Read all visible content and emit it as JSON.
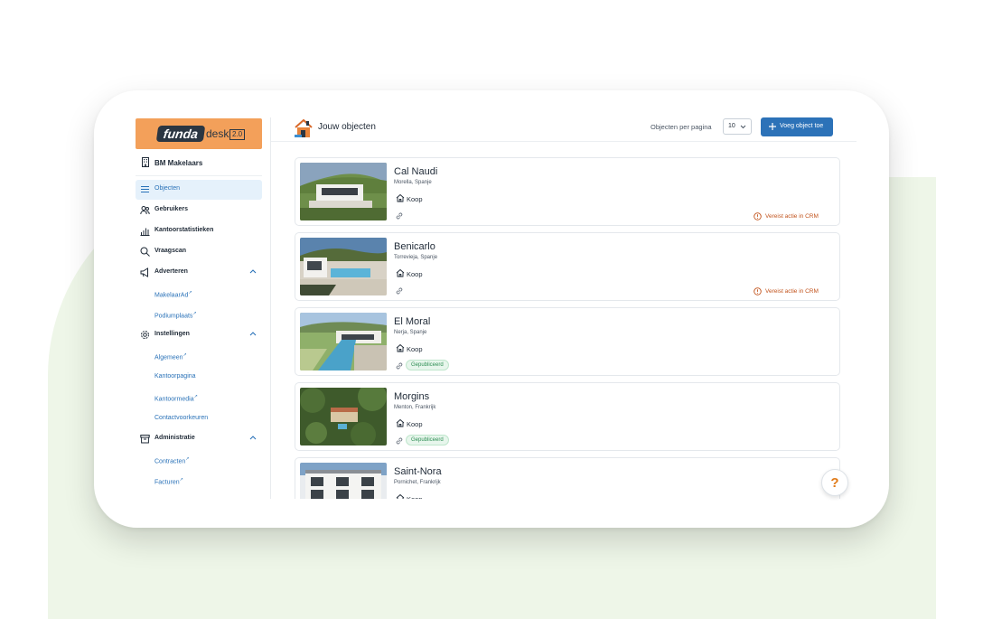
{
  "brand": {
    "logo_main": "funda",
    "logo_sub": "desk",
    "logo_version": "2.0"
  },
  "office": {
    "name": "BM Makelaars"
  },
  "sidebar": {
    "items": [
      {
        "label": "Objecten",
        "icon": "list-icon"
      },
      {
        "label": "Gebruikers",
        "icon": "users-icon"
      },
      {
        "label": "Kantoorstatistieken",
        "icon": "chart-icon"
      },
      {
        "label": "Vraagscan",
        "icon": "search-icon"
      },
      {
        "label": "Adverteren",
        "icon": "megaphone-icon"
      },
      {
        "label": "Instellingen",
        "icon": "gear-icon"
      },
      {
        "label": "Administratie",
        "icon": "archive-icon"
      }
    ],
    "adverteren_sub": [
      "MakelaarAd",
      "Podiumplaats"
    ],
    "instellingen_sub": [
      "Algemeen",
      "Kantoorpagina",
      "Kantoormedia",
      "Contactvoorkeuren"
    ],
    "administratie_sub": [
      "Contracten",
      "Facturen"
    ]
  },
  "header": {
    "title": "Jouw objecten",
    "per_page_label": "Objecten per pagina",
    "per_page_value": "10",
    "add_button": "Voeg object toe"
  },
  "objects": [
    {
      "name": "Cal Naudi",
      "location": "Morella, Spanje",
      "type": "Koop",
      "status": "Vereist actie in CRM"
    },
    {
      "name": "Benicarlo",
      "location": "Torrevieja, Spanje",
      "type": "Koop",
      "status": "Vereist actie in CRM"
    },
    {
      "name": "El Moral",
      "location": "Nerja, Spanje",
      "type": "Koop",
      "status": "Gepubliceerd"
    },
    {
      "name": "Morgins",
      "location": "Menton, Frankrijk",
      "type": "Koop",
      "status": "Gepubliceerd"
    },
    {
      "name": "Saint-Nora",
      "location": "Pornichet, Frankrijk",
      "type": "Koop",
      "status": ""
    }
  ],
  "colors": {
    "accent": "#2c72b8",
    "brand_orange": "#f3a05a",
    "warning": "#c2531c",
    "success": "#2f8f55"
  },
  "help": {
    "label": "?"
  }
}
